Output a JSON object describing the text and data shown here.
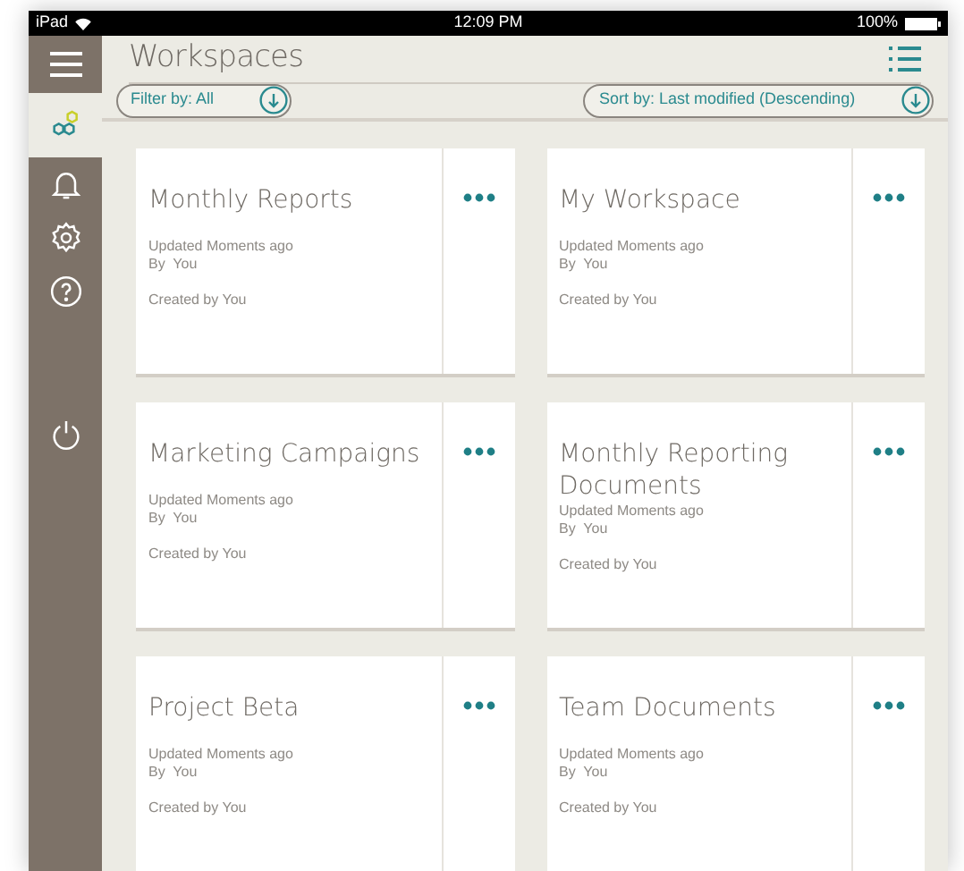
{
  "status_bar": {
    "device": "iPad",
    "time": "12:09 PM",
    "battery": "100%"
  },
  "header": {
    "title": "Workspaces"
  },
  "sidebar": {
    "items": [
      {
        "kind": "workspaces",
        "selected": true
      },
      {
        "kind": "notifications",
        "selected": false
      },
      {
        "kind": "settings",
        "selected": false
      },
      {
        "kind": "help",
        "selected": false
      },
      {
        "kind": "power",
        "selected": false
      }
    ]
  },
  "filter": {
    "label": "Filter by: All"
  },
  "sort": {
    "label": "Sort by: Last modified (Descending)"
  },
  "workspaces": [
    {
      "title": "Monthly Reports",
      "updated": "Updated Moments ago",
      "by": "By  You",
      "created": "Created by You"
    },
    {
      "title": "My Workspace",
      "updated": "Updated Moments ago",
      "by": "By  You",
      "created": "Created by You"
    },
    {
      "title": "Marketing Campaigns",
      "updated": "Updated Moments ago",
      "by": "By  You",
      "created": "Created by You"
    },
    {
      "title": "Monthly Reporting Documents",
      "updated": "Updated Moments ago",
      "by": "By  You",
      "created": "Created by You"
    },
    {
      "title": "Project Beta",
      "updated": "Updated Moments ago",
      "by": "By  You",
      "created": "Created by You"
    },
    {
      "title": "Team Documents",
      "updated": "Updated Moments ago",
      "by": "By  You",
      "created": "Created by You"
    }
  ]
}
